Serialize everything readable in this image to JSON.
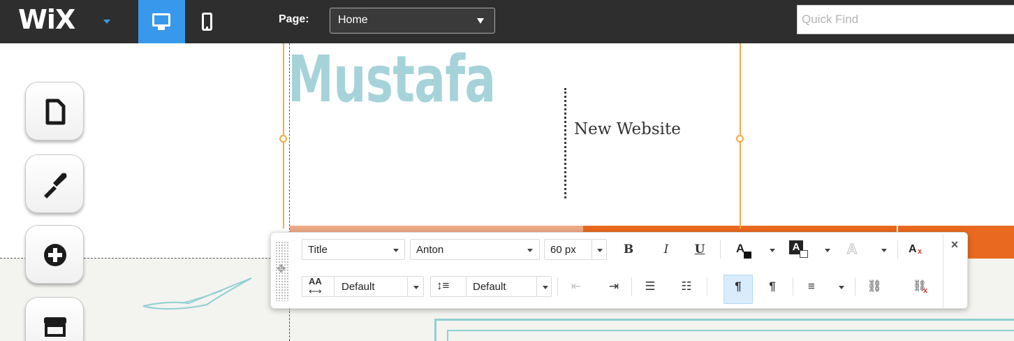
{
  "topbar": {
    "logo": "WiX",
    "page_label": "Page:",
    "page_value": "Home",
    "quick_find_placeholder": "Quick Find"
  },
  "site": {
    "title": "Mustafa",
    "tagline": "New Website"
  },
  "side_tools": [
    {
      "name": "pages",
      "icon": "page-icon"
    },
    {
      "name": "design",
      "icon": "paintbrush-icon"
    },
    {
      "name": "add",
      "icon": "plus-circle-icon"
    },
    {
      "name": "store",
      "icon": "store-icon"
    }
  ],
  "text_toolbar": {
    "style": "Title",
    "font": "Anton",
    "size": "60 px",
    "bold": "B",
    "italic": "I",
    "underline": "U",
    "char_spacing_icon": "AA",
    "char_spacing": "Default",
    "line_height": "Default",
    "close": "×"
  },
  "colors": {
    "topbar_bg": "#2e2e2e",
    "accent_blue": "#3899ec",
    "title_color": "#a6d3d9",
    "orange": "#e8691f",
    "guide_orange": "#f7a940"
  }
}
